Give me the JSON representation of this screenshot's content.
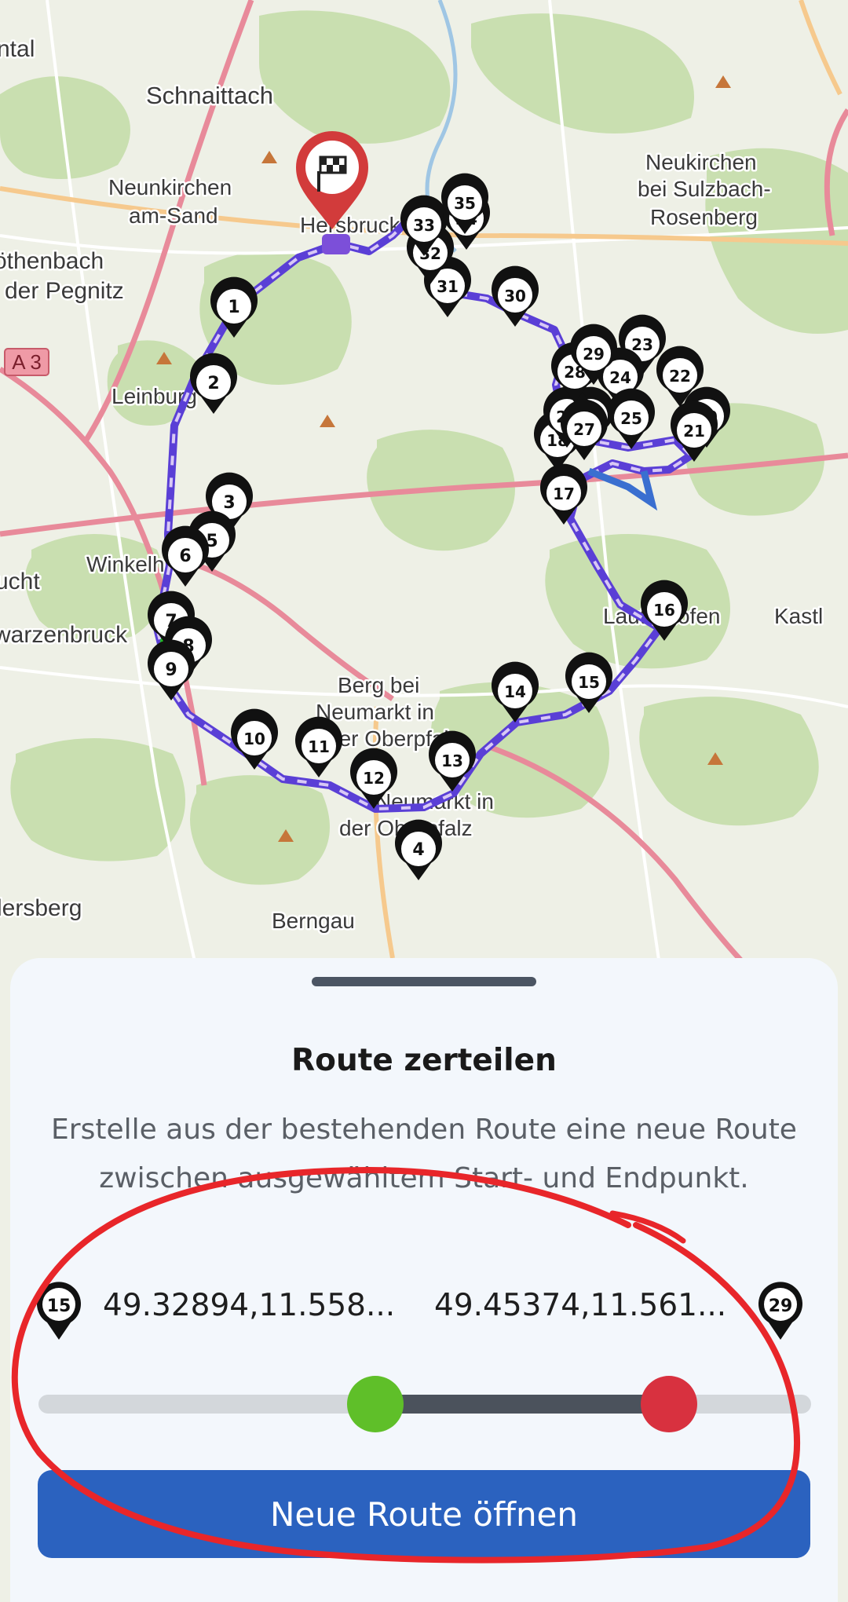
{
  "map": {
    "places": [
      {
        "label": "ntal"
      },
      {
        "label": "Schnaittach"
      },
      {
        "label": "Neukirchen"
      },
      {
        "label": "bei Sulzbach-"
      },
      {
        "label": "Rosenberg"
      },
      {
        "label": "Neunkirchen"
      },
      {
        "label": "am-Sand"
      },
      {
        "label": "Hersbruck"
      },
      {
        "label": "öthenbach"
      },
      {
        "label": "der Pegnitz"
      },
      {
        "label": "Leinburg"
      },
      {
        "label": "Winkelhaid"
      },
      {
        "label": "ucht"
      },
      {
        "label": "warzenbruck"
      },
      {
        "label": "Lauterhofen"
      },
      {
        "label": "Kastl"
      },
      {
        "label": "Berg bei"
      },
      {
        "label": "Neumarkt in"
      },
      {
        "label": "der Oberpfalz"
      },
      {
        "label": "Neumarkt in"
      },
      {
        "label": "der Oberpfalz"
      },
      {
        "label": "lersberg"
      },
      {
        "label": "Berngau"
      },
      {
        "label": "4"
      }
    ],
    "road_badge": "A 3",
    "waypoints": [
      "1",
      "2",
      "3",
      "4",
      "5",
      "6",
      "7",
      "8",
      "9",
      "10",
      "11",
      "12",
      "13",
      "14",
      "15",
      "16",
      "17",
      "18",
      "19",
      "20",
      "21",
      "22",
      "23",
      "24",
      "25",
      "26",
      "27",
      "28",
      "29",
      "30",
      "31",
      "32",
      "33",
      "34",
      "35"
    ],
    "colors": {
      "route": "#5a3fd6",
      "route_dash": "#d8c8f5",
      "finish_pin": "#d23b3b",
      "start_pin": "#22c022"
    }
  },
  "panel": {
    "title": "Route zerteilen",
    "description": "Erstelle aus der bestehenden Route eine neue Route zwischen ausgewähltem Start- und Endpunkt.",
    "start": {
      "number": "15",
      "coordinate": "49.32894,11.558..."
    },
    "end": {
      "number": "29",
      "coordinate": "49.45374,11.561..."
    },
    "slider": {
      "start_fraction": 0.436,
      "end_fraction": 0.816
    },
    "button_label": "Neue Route öffnen",
    "colors": {
      "button": "#2b62bf",
      "thumb_start": "#5fbf29",
      "thumb_end": "#d8313f",
      "annotation": "#e8262a"
    }
  }
}
